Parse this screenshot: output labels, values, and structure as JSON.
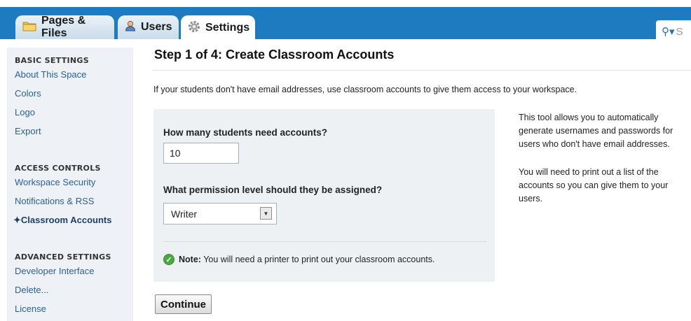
{
  "tabs": [
    {
      "label": "Pages & Files",
      "icon": "folder-icon"
    },
    {
      "label": "Users",
      "icon": "user-icon"
    },
    {
      "label": "Settings",
      "icon": "gear-icon",
      "active": true
    }
  ],
  "search": {
    "placeholder": "S"
  },
  "sidebar": {
    "sections": [
      {
        "heading": "BASIC SETTINGS",
        "items": [
          "About This Space",
          "Colors",
          "Logo",
          "Export"
        ]
      },
      {
        "heading": "ACCESS CONTROLS",
        "items": [
          "Workspace Security",
          "Notifications & RSS",
          "Classroom Accounts"
        ]
      },
      {
        "heading": "ADVANCED SETTINGS",
        "items": [
          "Developer Interface",
          "Delete...",
          "License"
        ]
      }
    ],
    "current_marker": "✦",
    "current_item": "Classroom Accounts"
  },
  "main": {
    "title": "Step 1 of 4: Create Classroom Accounts",
    "intro": "If your students don't have email addresses, use classroom accounts to give them access to your workspace.",
    "question_count": "How many students need accounts?",
    "count_value": "10",
    "question_permission": "What permission level should they be assigned?",
    "permission_value": "Writer",
    "note_label": "Note:",
    "note_text": " You will need a printer to print out your classroom accounts.",
    "side_text_1": "This tool allows you to automatically generate usernames and passwords for users who don't have email addresses.",
    "side_text_2": "You will need to print out a list of the accounts so you can give them to your users.",
    "continue_label": "Continue"
  },
  "colors": {
    "topbar": "#1f7bbf",
    "sidebar_bg": "#eef2f6",
    "panel_bg": "#eef1f4",
    "link": "#2b5f93"
  }
}
